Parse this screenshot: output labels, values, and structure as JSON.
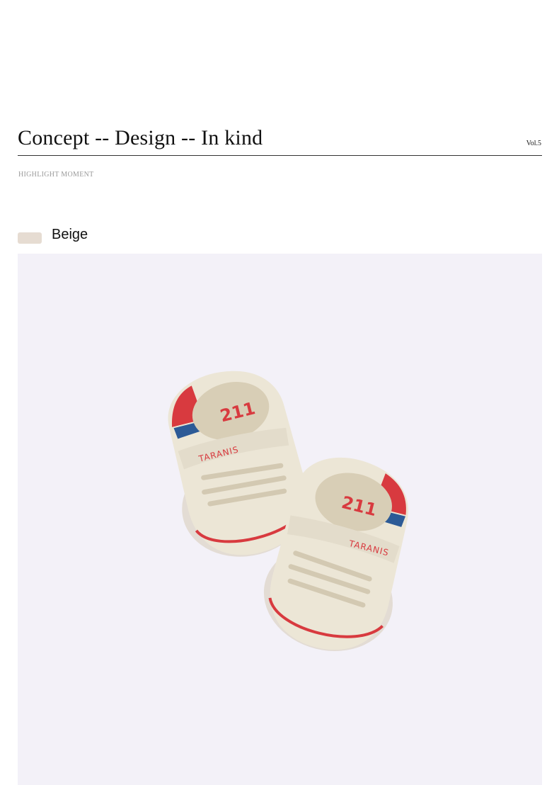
{
  "header": {
    "title": "Concept -- Design -- In kind",
    "volume": "Vol.5",
    "subtitle": "HIGHLIGHT MOMENT"
  },
  "variant": {
    "color_name": "Beige",
    "swatch_color": "#e6dcd2"
  },
  "photo": {
    "background_color": "#f3f1f8",
    "shoe_color": "#ece6d6",
    "accent_red": "#d83a3f",
    "accent_blue": "#2c5a96",
    "brand_text": "TARANIS",
    "logo_text": "211"
  }
}
